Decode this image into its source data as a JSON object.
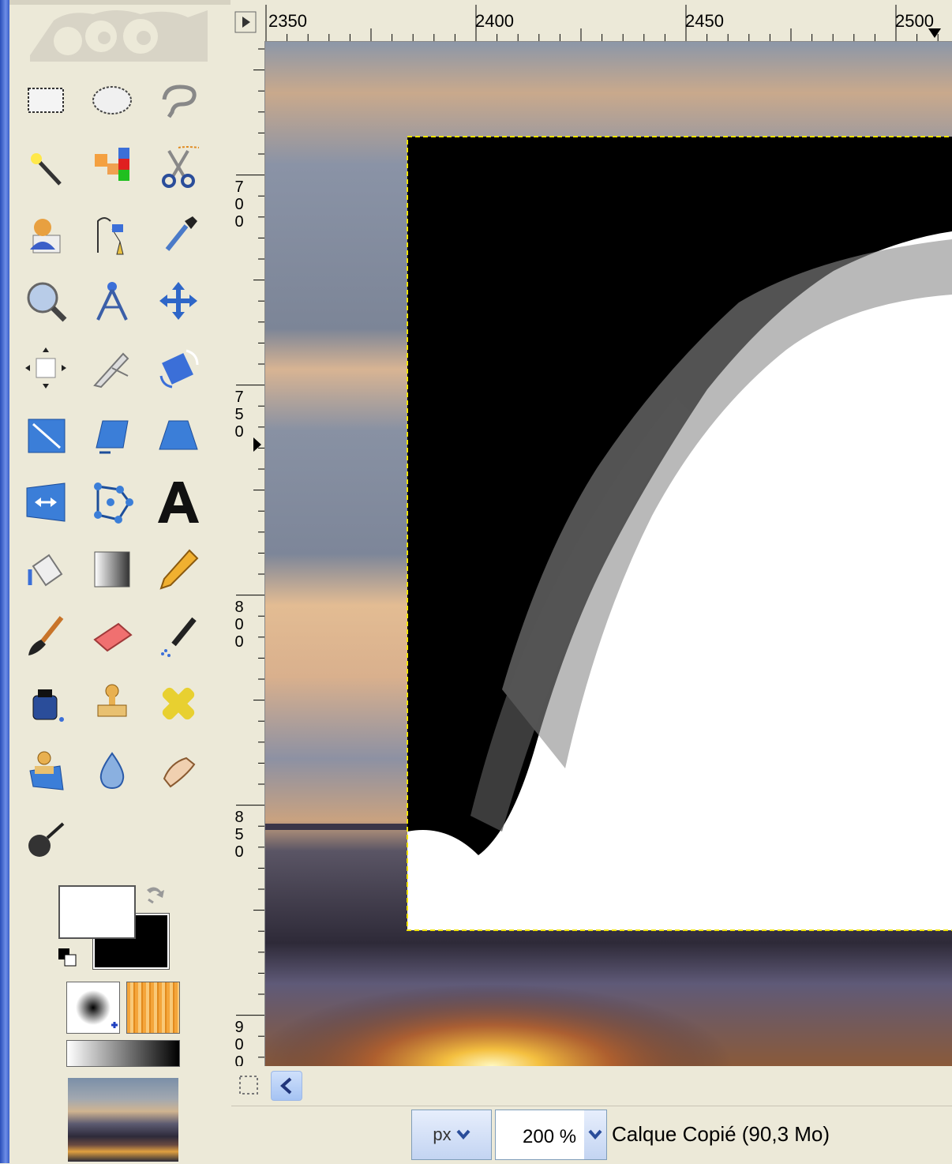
{
  "ruler": {
    "horizontal": [
      "2350",
      "2400",
      "2450",
      "2500"
    ],
    "vertical": [
      "700",
      "750",
      "800",
      "850",
      "900"
    ]
  },
  "toolbox": {
    "tools": [
      "rect-select-icon",
      "ellipse-select-icon",
      "free-select-icon",
      "fuzzy-select-icon",
      "select-by-color-icon",
      "scissors-select-icon",
      "foreground-select-icon",
      "paths-icon",
      "color-picker-icon",
      "zoom-icon",
      "measure-icon",
      "move-icon",
      "align-icon",
      "crop-icon",
      "rotate-icon",
      "scale-icon",
      "shear-icon",
      "perspective-icon",
      "flip-icon",
      "cage-transform-icon",
      "text-icon",
      "bucket-fill-icon",
      "blend-icon",
      "pencil-icon",
      "paintbrush-icon",
      "eraser-icon",
      "airbrush-icon",
      "ink-icon",
      "clone-icon",
      "heal-icon",
      "perspective-clone-icon",
      "blur-sharpen-icon",
      "smudge-icon",
      "dodge-burn-icon"
    ],
    "foreground_color": "#ffffff",
    "background_color": "#000000"
  },
  "status": {
    "unit": "px",
    "zoom": "200 %",
    "layer_info": "Calque Copié (90,3 Mo)"
  },
  "colors": {
    "selection_border": "#f2e400",
    "canvas_black": "#000000",
    "window_border": "#3a5fc8"
  }
}
